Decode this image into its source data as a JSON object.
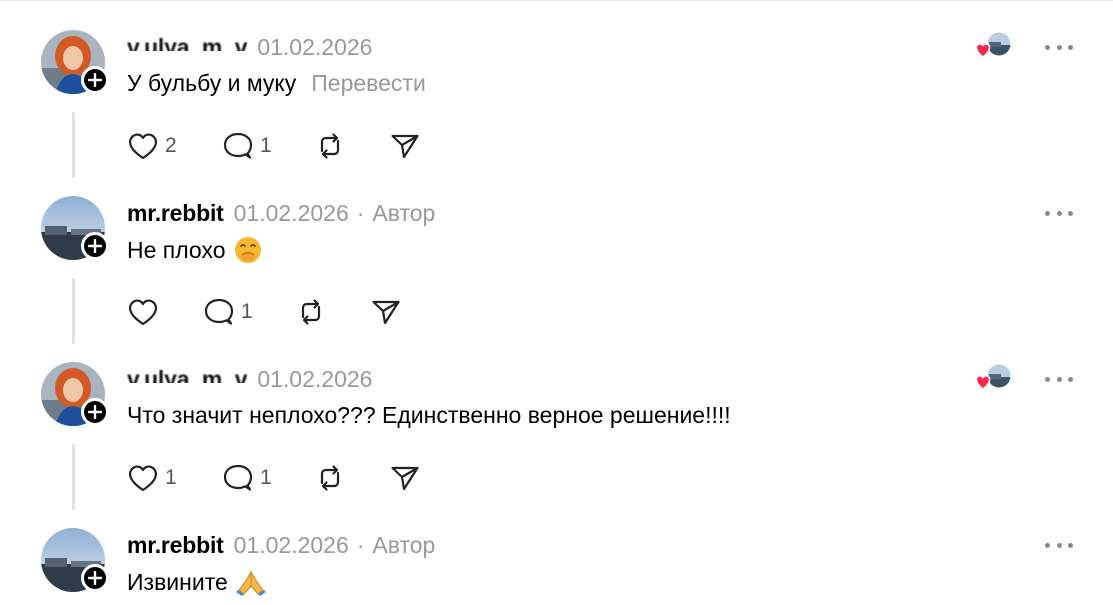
{
  "comments": [
    {
      "username": "v.ulya_m_v",
      "username_blurred": true,
      "date": "01.02.2026",
      "author_tag": "",
      "text": "У бульбу и муку",
      "translate_label": "Перевести",
      "emoji": "",
      "likes": "2",
      "replies": "1",
      "liked_by_author": true,
      "avatar": "woman-red-hair"
    },
    {
      "username": "mr.rebbit",
      "username_blurred": false,
      "date": "01.02.2026",
      "author_tag": "Автор",
      "text": "Не плохо",
      "translate_label": "",
      "emoji": "hand-over-mouth-emoji",
      "likes": "",
      "replies": "1",
      "liked_by_author": false,
      "avatar": "landscape-sky"
    },
    {
      "username": "v.ulya_m_v",
      "username_blurred": true,
      "date": "01.02.2026",
      "author_tag": "",
      "text": "Что значит неплохо??? Единственно верное решение!!!!",
      "translate_label": "",
      "emoji": "",
      "likes": "1",
      "replies": "1",
      "liked_by_author": true,
      "avatar": "woman-red-hair"
    },
    {
      "username": "mr.rebbit",
      "username_blurred": false,
      "date": "01.02.2026",
      "author_tag": "Автор",
      "text": "Извините",
      "translate_label": "",
      "emoji": "folded-hands-emoji",
      "avatar": "landscape-sky"
    }
  ],
  "dot_separator": "·",
  "icons": {
    "like": "heart-icon",
    "reply": "speech-bubble-icon",
    "repost": "repost-icon",
    "share": "send-icon",
    "more": "more-dots-icon",
    "follow": "plus-icon"
  },
  "colors": {
    "muted": "#999999",
    "like_red": "#ff2a4a"
  }
}
